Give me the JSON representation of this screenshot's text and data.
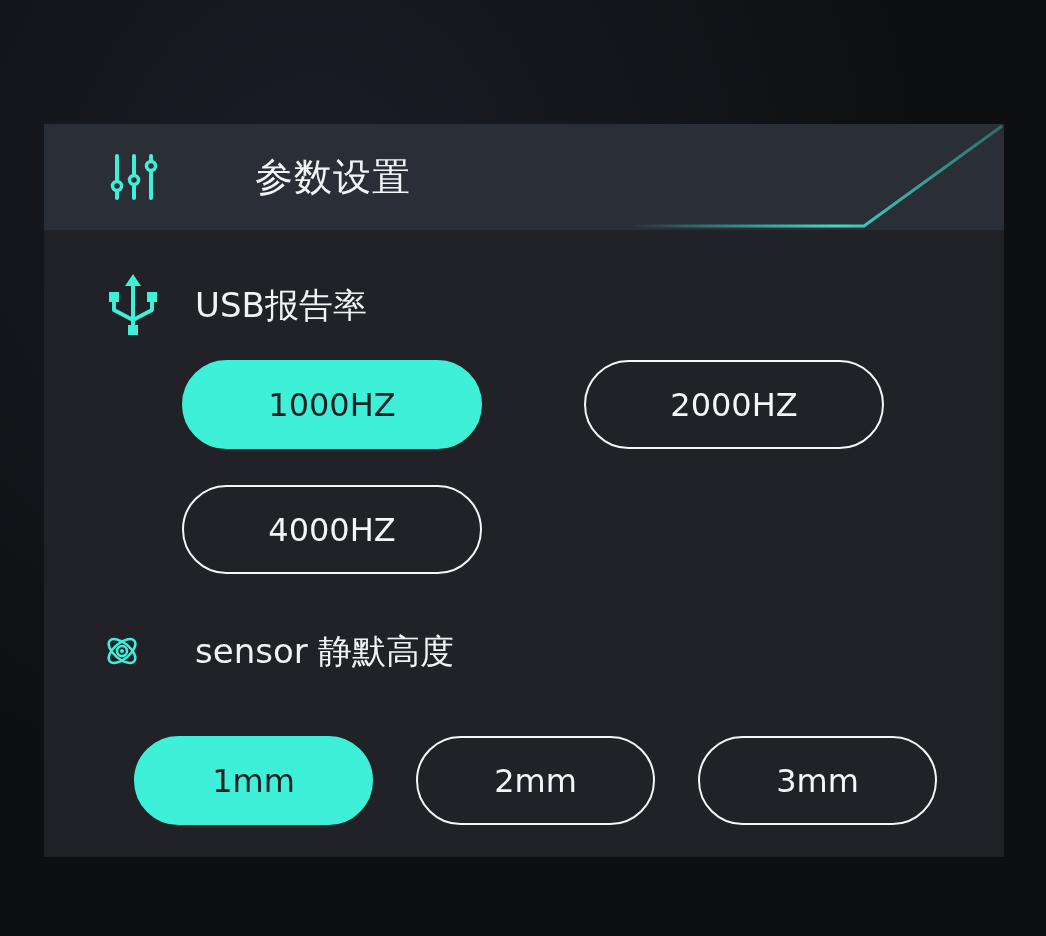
{
  "header": {
    "title": "参数设置"
  },
  "sections": [
    {
      "kind": "report_rate",
      "label": "USB报告率",
      "options": [
        {
          "label": "1000HZ",
          "selected": true
        },
        {
          "label": "2000HZ",
          "selected": false
        },
        {
          "label": "4000HZ",
          "selected": false
        }
      ]
    },
    {
      "kind": "lift_height",
      "label": "sensor 静默高度",
      "options": [
        {
          "label": "1mm",
          "selected": true
        },
        {
          "label": "2mm",
          "selected": false
        },
        {
          "label": "3mm",
          "selected": false
        }
      ]
    }
  ]
}
